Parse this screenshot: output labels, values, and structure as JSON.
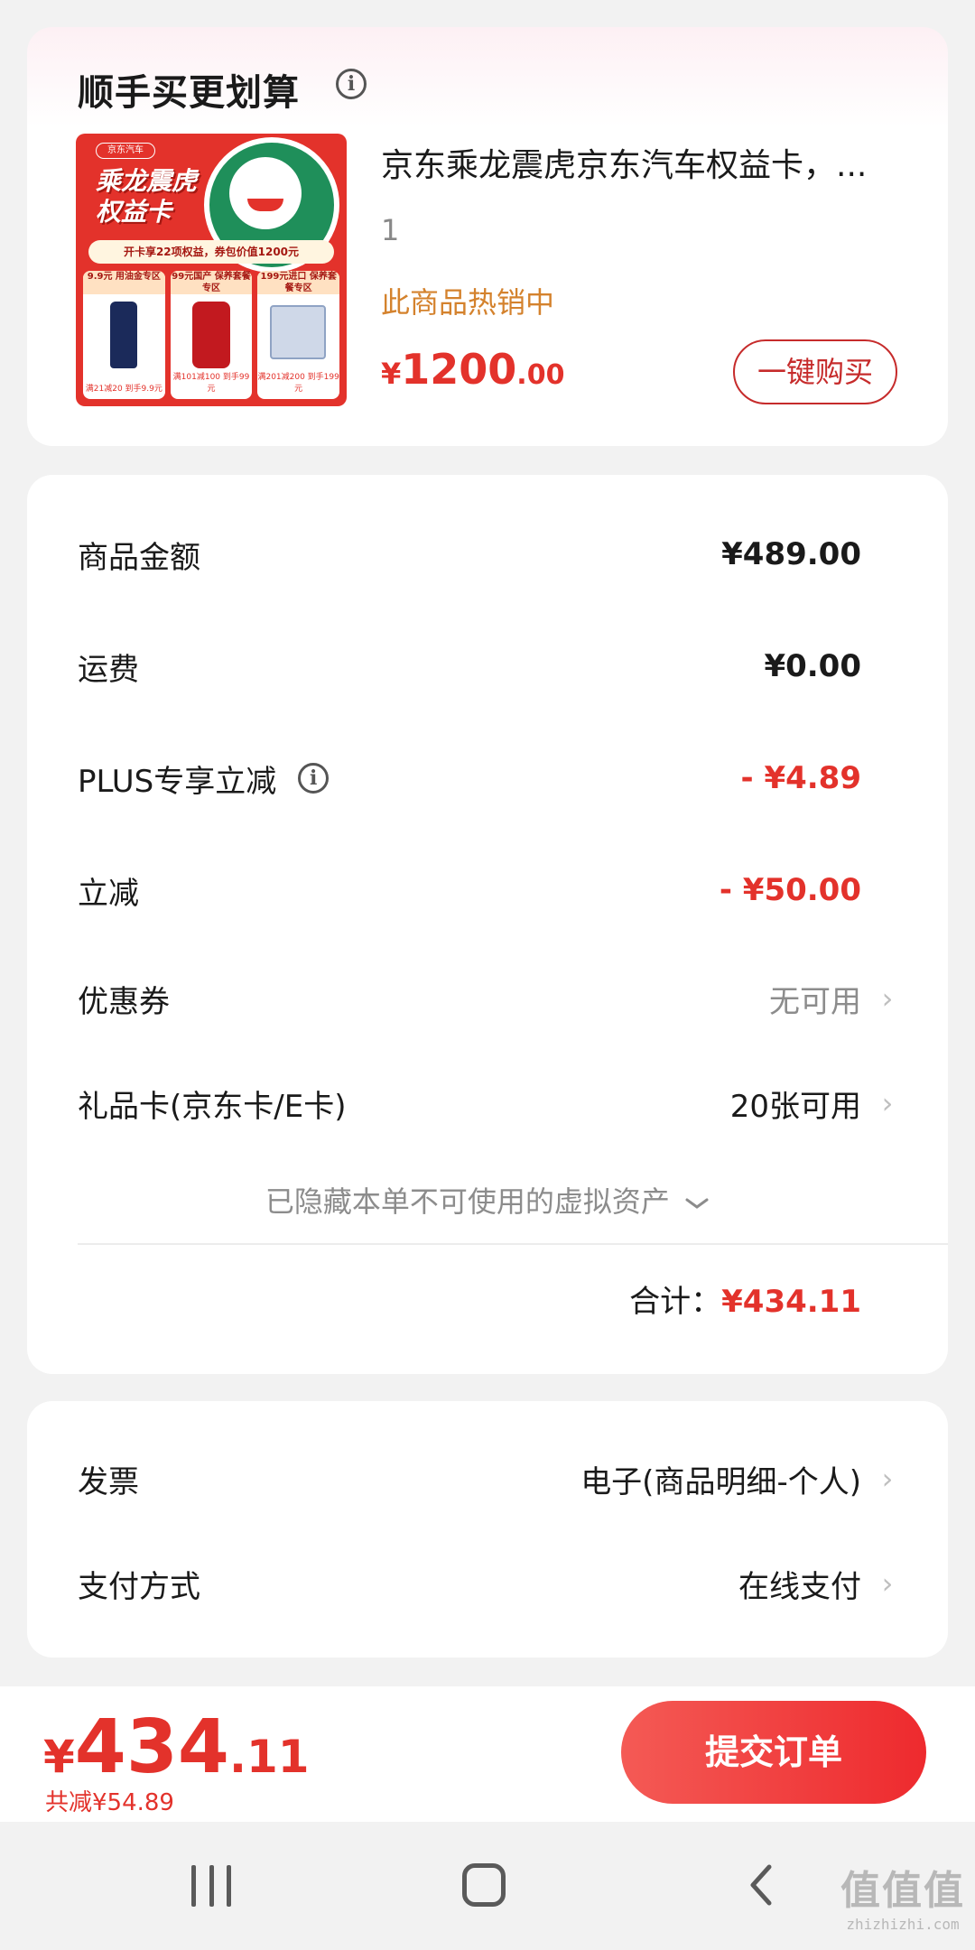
{
  "bundle": {
    "title": "顺手买更划算",
    "product_image": {
      "brand": "京东汽车",
      "title_line1": "乘龙震虎",
      "title_line2": "权益卡",
      "banner": "开卡享22项权益，券包价值1200元",
      "tiles": [
        {
          "head": "9.9元 用油金专区",
          "foot": "满21减20 到手9.9元"
        },
        {
          "head": "99元国产 保养套餐专区",
          "foot": "满101减100 到手99元"
        },
        {
          "head": "199元进口 保养套餐专区",
          "foot": "满201减200 到手199元"
        }
      ]
    },
    "product_name": "京东乘龙震虎京东汽车权益卡，...",
    "quantity": "1",
    "hot_label": "此商品热销中",
    "price_symbol": "¥",
    "price_int": "1200",
    "price_dec": ".00",
    "buy_button": "一键购买"
  },
  "amounts": {
    "goods_amount": {
      "label": "商品金额",
      "value": "¥489.00"
    },
    "shipping": {
      "label": "运费",
      "value": "¥0.00"
    },
    "plus_discount": {
      "label": "PLUS专享立减",
      "value": "- ¥4.89"
    },
    "instant_discount": {
      "label": "立减",
      "value": "- ¥50.00"
    },
    "coupon": {
      "label": "优惠券",
      "value": "无可用"
    },
    "gift_card": {
      "label": "礼品卡(京东卡/E卡)",
      "value": "20张可用"
    },
    "hidden_assets": "已隐藏本单不可使用的虚拟资产",
    "total_label": "合计：",
    "total_value": "¥434.11"
  },
  "invoice": {
    "invoice": {
      "label": "发票",
      "value": "电子(商品明细-个人)"
    },
    "payment": {
      "label": "支付方式",
      "value": "在线支付"
    }
  },
  "bottom_bar": {
    "price_symbol": "¥",
    "price_int": "434",
    "price_dec": ".11",
    "saved": "共减¥54.89",
    "submit_button": "提交订单"
  },
  "watermark": {
    "logo": "值值值",
    "site": "zhizhizhi.com"
  },
  "colors": {
    "accent_red": "#e3322b",
    "hot_orange": "#d4822d",
    "background": "#f2f2f2"
  }
}
